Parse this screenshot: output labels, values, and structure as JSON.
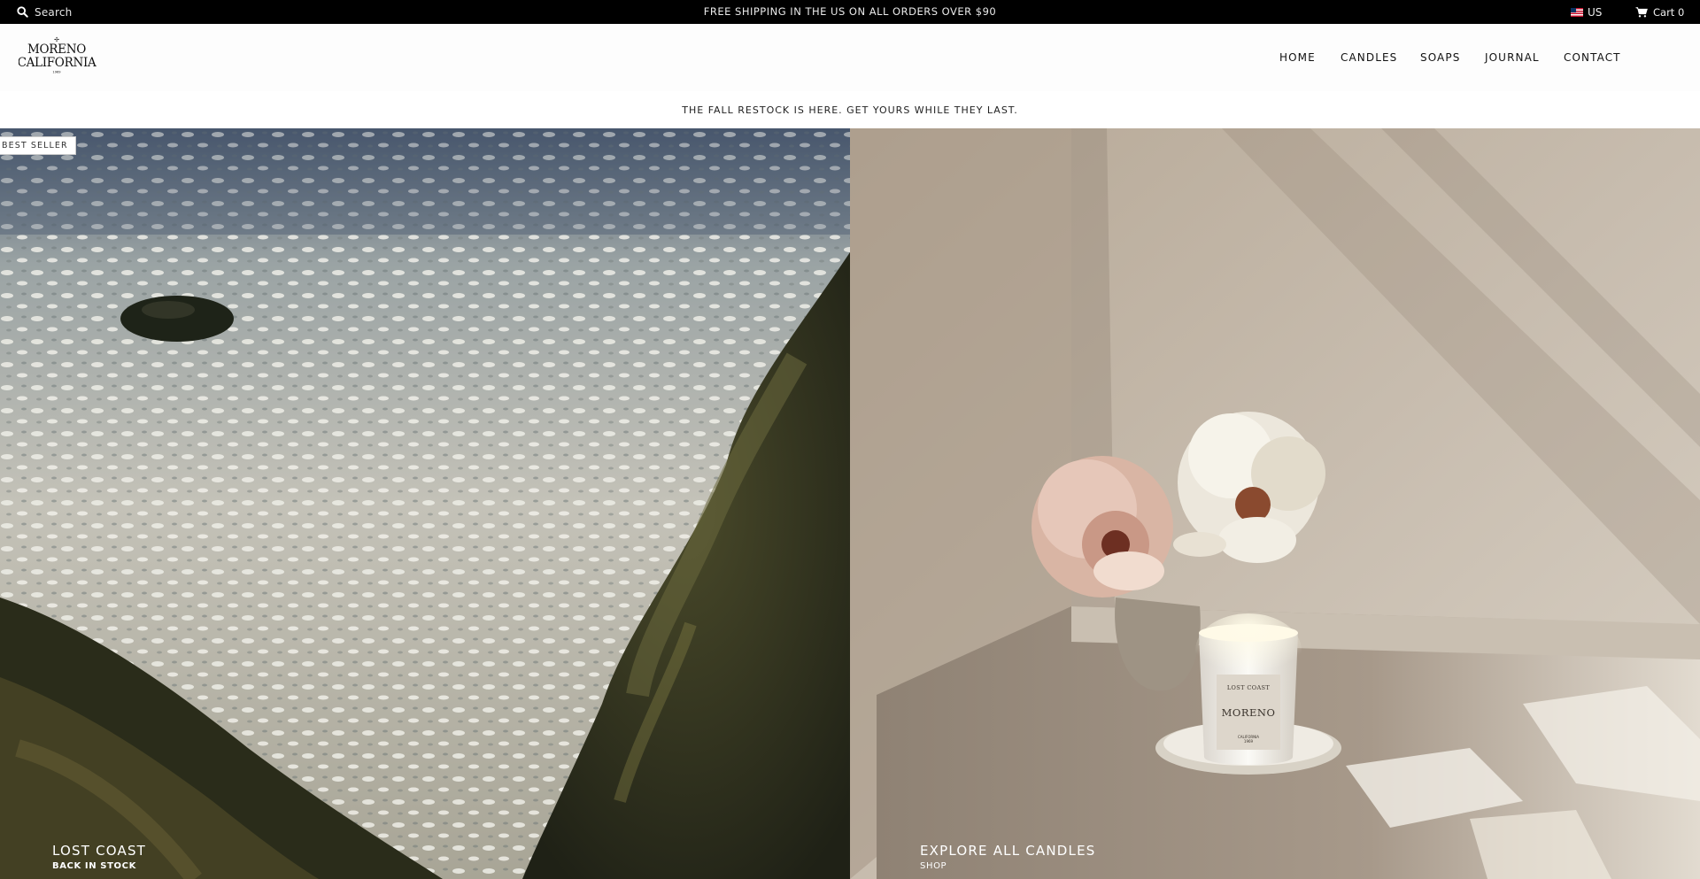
{
  "topbar": {
    "search_label": "Search",
    "announcement": "FREE SHIPPING IN THE US ON ALL ORDERS OVER $90",
    "locale_label": "US",
    "cart_label": "Cart 0"
  },
  "header": {
    "logo": {
      "line1": "MORENO",
      "line2": "CALIFORNIA",
      "line3": "1969"
    },
    "nav": [
      {
        "label": "HOME"
      },
      {
        "label": "CANDLES"
      },
      {
        "label": "SOAPS"
      },
      {
        "label": "JOURNAL"
      },
      {
        "label": "CONTACT"
      }
    ]
  },
  "promo": {
    "text": "THE FALL RESTOCK IS HERE. GET YOURS WHILE THEY LAST."
  },
  "hero": {
    "left": {
      "badge": "BEST SELLER",
      "title": "LOST COAST",
      "subtitle": "BACK IN STOCK"
    },
    "right": {
      "title": "EXPLORE ALL CANDLES",
      "subtitle": "SHOP",
      "candle_label": {
        "top": "LOST COAST",
        "brand": "MORENO",
        "bottom1": "CALIFORNIA",
        "bottom2": "1969"
      }
    }
  },
  "colors": {
    "topbar_bg": "#000000",
    "header_bg": "#fdfdfd",
    "ocean": "#6f7a7c",
    "wall": "#bcaf9f"
  },
  "icons": {
    "search": "search-icon",
    "cart": "cart-icon",
    "flag": "us-flag-icon"
  }
}
